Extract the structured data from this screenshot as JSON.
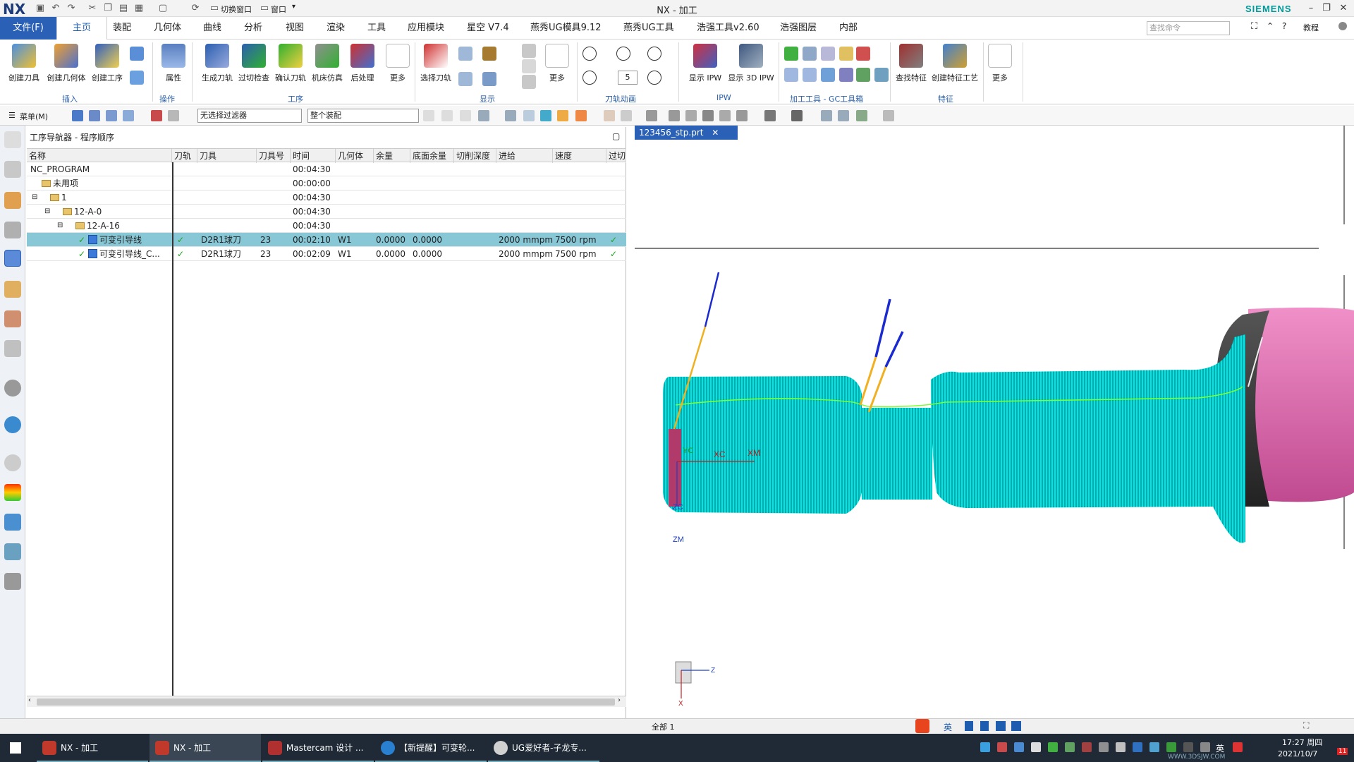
{
  "titlebar": {
    "logo": "NX",
    "title": "NX - 加工",
    "brand": "SIEMENS",
    "switch_window": "切换窗口",
    "window_menu": "窗口"
  },
  "menu": {
    "file": "文件(F)",
    "tabs": [
      "主页",
      "装配",
      "几何体",
      "曲线",
      "分析",
      "视图",
      "渲染",
      "工具",
      "应用模块",
      "星空 V7.4",
      "燕秀UG模具9.12",
      "燕秀UG工具",
      "浩强工具v2.60",
      "浩强图层",
      "内部"
    ],
    "search_placeholder": "查找命令",
    "tutorial": "教程"
  },
  "ribbon": {
    "buttons": [
      "创建刀具",
      "创建几何体",
      "创建工序",
      "属性",
      "生成刀轨",
      "过切检查",
      "确认刀轨",
      "机床仿真",
      "后处理",
      "更多",
      "选择刀轨",
      "更多",
      "显示 IPW",
      "显示 3D IPW",
      "查找特征",
      "创建特征工艺",
      "更多"
    ],
    "spin_value": "5",
    "groups": [
      "插入",
      "操作",
      "工序",
      "显示",
      "刀轨动画",
      "IPW",
      "加工工具 - GC工具箱",
      "特征"
    ]
  },
  "toolbar2": {
    "menu": "菜单(M)",
    "filter": "无选择过滤器",
    "assembly": "整个装配"
  },
  "navigator": {
    "title": "工序导航器 - 程序顺序",
    "columns": [
      "名称",
      "刀轨",
      "刀具",
      "刀具号",
      "时间",
      "几何体",
      "余量",
      "底面余量",
      "切削深度",
      "进给",
      "速度",
      "过切"
    ],
    "rows": [
      {
        "name": "NC_PROGRAM",
        "tool": "",
        "num": "",
        "time": "00:04:30",
        "geom": "",
        "stock": "",
        "floor": "",
        "feed": "",
        "speed": ""
      },
      {
        "name": "未用项",
        "tool": "",
        "num": "",
        "time": "00:00:00",
        "geom": "",
        "stock": "",
        "floor": "",
        "feed": "",
        "speed": ""
      },
      {
        "name": "1",
        "tool": "",
        "num": "",
        "time": "00:04:30",
        "geom": "",
        "stock": "",
        "floor": "",
        "feed": "",
        "speed": ""
      },
      {
        "name": "12-A-0",
        "tool": "",
        "num": "",
        "time": "00:04:30",
        "geom": "",
        "stock": "",
        "floor": "",
        "feed": "",
        "speed": ""
      },
      {
        "name": "12-A-16",
        "tool": "",
        "num": "",
        "time": "00:04:30",
        "geom": "",
        "stock": "",
        "floor": "",
        "feed": "",
        "speed": ""
      },
      {
        "name": "可变引导线",
        "tool": "D2R1球刀",
        "num": "23",
        "time": "00:02:10",
        "geom": "W1",
        "stock": "0.0000",
        "floor": "0.0000",
        "feed": "2000 mmpm",
        "speed": "7500 rpm"
      },
      {
        "name": "可变引导线_C...",
        "tool": "D2R1球刀",
        "num": "23",
        "time": "00:02:09",
        "geom": "W1",
        "stock": "0.0000",
        "floor": "0.0000",
        "feed": "2000 mmpm",
        "speed": "7500 rpm"
      }
    ],
    "checkmark": "✓"
  },
  "viewport": {
    "tab": "123456_stp.prt",
    "axis_labels": [
      "XC",
      "XM",
      "YC",
      "ZC",
      "ZM",
      "Z",
      "X"
    ]
  },
  "statusbar": {
    "text": "全部 1",
    "ime_lang": "英"
  },
  "taskbar": {
    "apps": [
      "NX - 加工",
      "NX - 加工",
      "Mastercam 设计 ...",
      "【新提醒】可变轮...",
      "UG爱好者-子龙专..."
    ],
    "time": "17:27 周四",
    "date": "2021/10/7",
    "lang": "英",
    "badge": "11",
    "watermark": "WWW.3DSJW.COM"
  },
  "colors": {
    "accent": "#2a60b6",
    "toolpath": "#00e5e5",
    "part_pink": "#e070b8",
    "selected_row": "#87c7d6"
  }
}
